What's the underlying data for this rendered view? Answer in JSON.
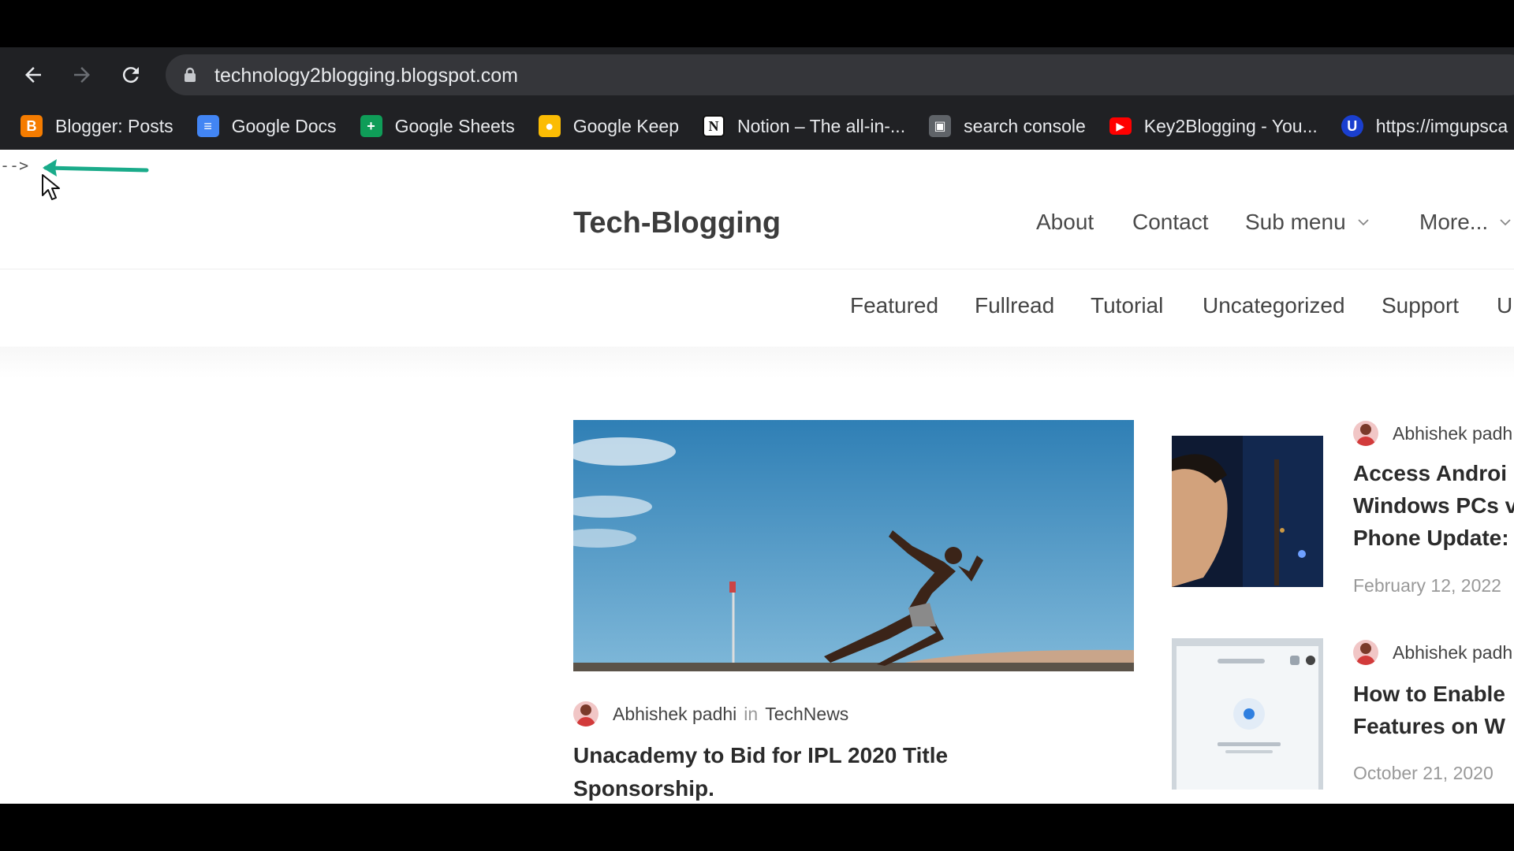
{
  "browser": {
    "url": "technology2blogging.blogspot.com",
    "bookmarks": [
      {
        "label": "Blogger: Posts",
        "icon": "blogger-icon",
        "color": "#f57c00",
        "glyph": "B"
      },
      {
        "label": "Google Docs",
        "icon": "docs-icon",
        "color": "#4285f4",
        "glyph": "≡"
      },
      {
        "label": "Google Sheets",
        "icon": "sheets-icon",
        "color": "#0f9d58",
        "glyph": "+"
      },
      {
        "label": "Google Keep",
        "icon": "keep-icon",
        "color": "#fbbc04",
        "glyph": "●"
      },
      {
        "label": "Notion – The all-in-...",
        "icon": "notion-icon",
        "color": "#ffffff",
        "glyph": "N"
      },
      {
        "label": "search console",
        "icon": "search-console-icon",
        "color": "#5f6368",
        "glyph": "▣"
      },
      {
        "label": "Key2Blogging - You...",
        "icon": "youtube-icon",
        "color": "#ff0000",
        "glyph": "▶"
      },
      {
        "label": "https://imgupsca",
        "icon": "upscale-icon",
        "color": "#1a3fcf",
        "glyph": "U"
      }
    ]
  },
  "page": {
    "comment_text": "-->",
    "site_title": "Tech-Blogging",
    "nav": {
      "about": "About",
      "contact": "Contact",
      "submenu": "Sub menu",
      "more": "More..."
    },
    "categories": [
      "Featured",
      "Fullread",
      "Tutorial",
      "Uncategorized",
      "Support",
      "U"
    ],
    "featured_post": {
      "author": "Abhishek padhi",
      "in": "in",
      "category": "TechNews",
      "title": "Unacademy to Bid for IPL 2020 Title Sponsorship."
    },
    "side_posts": [
      {
        "author": "Abhishek padh",
        "title_lines": [
          "Access Androi",
          "Windows PCs v",
          "Phone Update:"
        ],
        "date": "February 12, 2022"
      },
      {
        "author": "Abhishek padh",
        "title_lines": [
          "How to Enable",
          "Features on W"
        ],
        "date": "October 21, 2020"
      }
    ]
  },
  "colors": {
    "chrome_bg": "#202124",
    "omnibox_bg": "#35363a",
    "annotation_arrow": "#1aab8a"
  }
}
